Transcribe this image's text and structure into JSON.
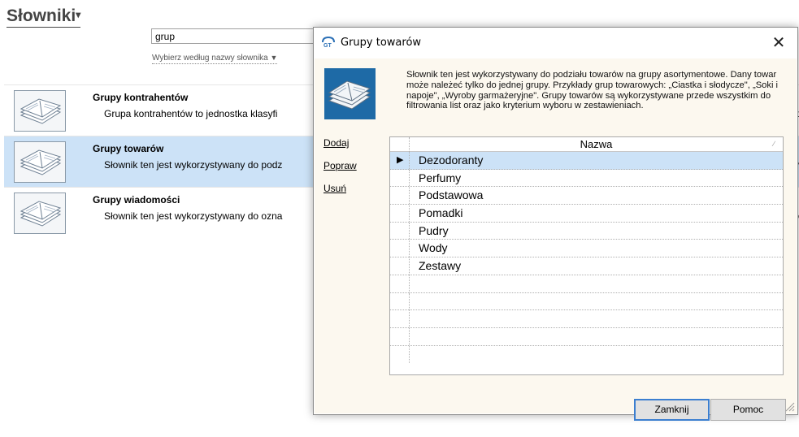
{
  "page": {
    "title": "Słowniki",
    "search_value": "grup",
    "search_mode": "Wybierz według nazwy słownika"
  },
  "dictionaries": [
    {
      "name": "Grupy kontrahentów",
      "description": "Grupa kontrahentów to jednostka klasyfi",
      "trailing": "t"
    },
    {
      "name": "Grupy towarów",
      "description": "Słownik ten jest wykorzystywany do podz",
      "trailing": "y",
      "selected": true
    },
    {
      "name": "Grupy wiadomości",
      "description": "Słownik ten jest wykorzystywany do ozna",
      "trailing": "o"
    }
  ],
  "dialog": {
    "title": "Grupy towarów",
    "description": "Słownik ten jest wykorzystywany do podziału towarów na grupy asortymentowe. Dany towar może należeć tylko do jednej grupy. Przykłady grup towarowych: „Ciastka i słodycze\", „Soki i napoje\", „Wyroby garmażeryjne\". Grupy towarów są wykorzystywane przede wszystkim do filtrowania list oraz jako kryterium wyboru w zestawieniach.",
    "actions": {
      "add": "Dodaj",
      "edit": "Popraw",
      "delete": "Usuń"
    },
    "grid": {
      "column": "Nazwa",
      "rows": [
        "Dezodoranty",
        "Perfumy",
        "Podstawowa",
        "Pomadki",
        "Pudry",
        "Wody",
        "Zestawy"
      ],
      "current_row": 0
    },
    "buttons": {
      "close": "Zamknij",
      "help": "Pomoc"
    }
  },
  "icons": {
    "dictionary": "open-book-icon",
    "dialog_app": "gt-app-icon",
    "close": "close-icon",
    "row_pointer": "row-pointer-icon",
    "resize": "resize-grip-icon"
  },
  "colors": {
    "selection": "#cce2f7",
    "dialog_client": "#fcf8ef",
    "dialog_icon_bg": "#1e6aa6",
    "primary_button_border": "#3c7fd0"
  }
}
